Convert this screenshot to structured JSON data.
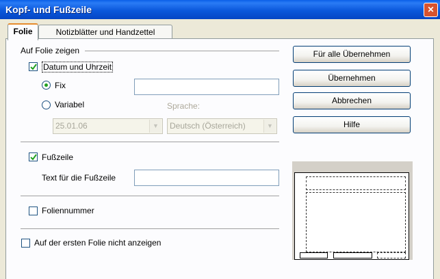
{
  "window": {
    "title": "Kopf- und Fußzeile",
    "close_label": "✕"
  },
  "tabs": [
    {
      "label": "Folie",
      "active": true
    },
    {
      "label": "Notizblätter und Handzettel",
      "active": false
    }
  ],
  "section": {
    "title": "Auf Folie zeigen"
  },
  "datetime": {
    "label": "Datum und Uhrzeit",
    "checked": true,
    "fix_label": "Fix",
    "fix_value": "",
    "variable_label": "Variabel",
    "date_format": "25.01.06",
    "language_label": "Sprache:",
    "language": "Deutsch (Österreich)"
  },
  "footer": {
    "label": "Fußzeile",
    "checked": true,
    "text_label": "Text für die Fußzeile",
    "text_value": ""
  },
  "slide_number": {
    "label": "Foliennummer",
    "checked": false
  },
  "first_slide": {
    "label": "Auf der ersten Folie nicht anzeigen",
    "checked": false
  },
  "buttons": {
    "apply_all": "Für alle Übernehmen",
    "apply": "Übernehmen",
    "cancel": "Abbrechen",
    "help": "Hilfe"
  },
  "icons": {
    "checkmark": "checkmark-icon",
    "dropdown": "chevron-down-icon",
    "close": "close-icon"
  }
}
